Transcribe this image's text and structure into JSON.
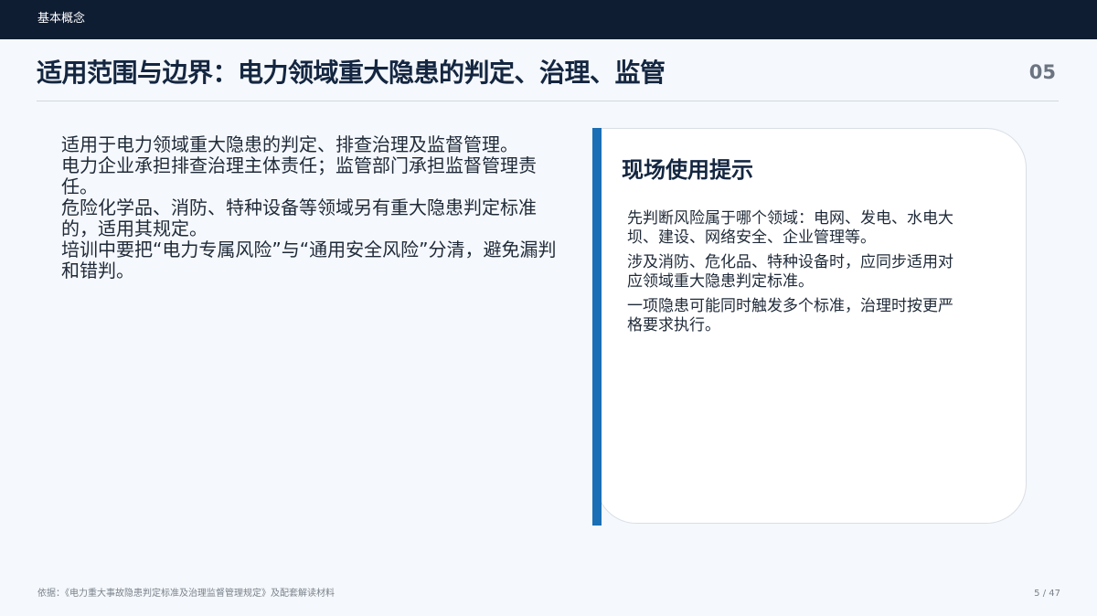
{
  "header": {
    "section_label": "基本概念"
  },
  "title": "适用范围与边界：电力领域重大隐患的判定、治理、监管",
  "section_number": "05",
  "main_points": [
    "适用于电力领域重大隐患的判定、排查治理及监督管理。",
    "电力企业承担排查治理主体责任；监管部门承担监督管理责任。",
    "危险化学品、消防、特种设备等领域另有重大隐患判定标准的，适用其规定。",
    "培训中要把“电力专属风险”与“通用安全风险”分清，避免漏判和错判。"
  ],
  "tip_card": {
    "heading": "现场使用提示",
    "items": [
      "先判断风险属于哪个领域：电网、发电、水电大坝、建设、网络安全、企业管理等。",
      "涉及消防、危化品、特种设备时，应同步适用对应领域重大隐患判定标准。",
      "一项隐患可能同时触发多个标准，治理时按更严格要求执行。"
    ]
  },
  "footer": {
    "source": "依据：《电力重大事故隐患判定标准及治理监督管理规定》及配套解读材料",
    "page": "5 / 47"
  },
  "colors": {
    "top_bar": "#0f1d33",
    "accent": "#1a6fb5",
    "background": "#f5f8fc",
    "title_text": "#142640"
  }
}
